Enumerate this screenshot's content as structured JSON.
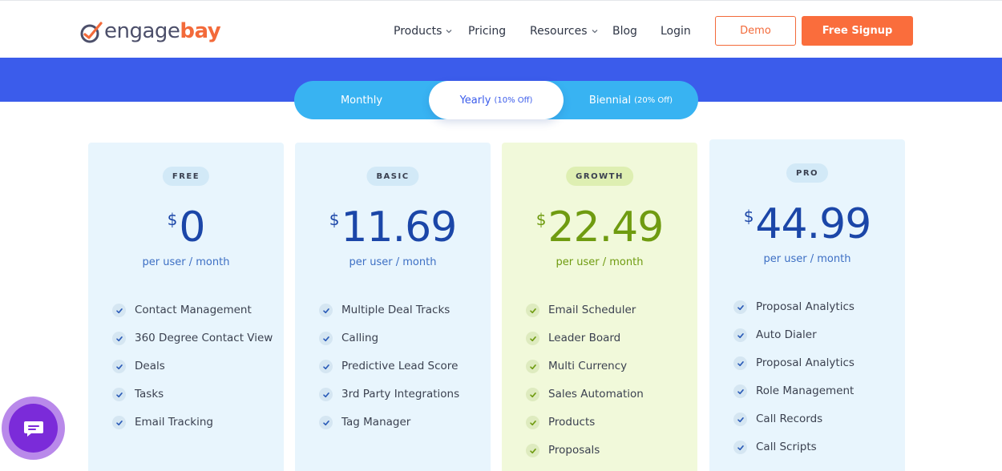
{
  "brand": {
    "logo_part1": "engage",
    "logo_part2": "bay",
    "primary_color": "#3b5ceb",
    "accent_color": "#fa6d3c"
  },
  "nav": {
    "products": "Products",
    "pricing": "Pricing",
    "resources": "Resources",
    "blog": "Blog",
    "login": "Login",
    "demo": "Demo",
    "signup": "Free Signup"
  },
  "billing_toggle": {
    "monthly": {
      "label": "Monthly"
    },
    "yearly": {
      "label": "Yearly",
      "note": "(10% Off)",
      "selected": true
    },
    "biennial": {
      "label": "Biennial",
      "note": "(20% Off)"
    }
  },
  "plans": [
    {
      "badge": "FREE",
      "currency": "$",
      "price": "0",
      "period": "per user / month",
      "features": [
        "Contact Management",
        "360 Degree Contact View",
        "Deals",
        "Tasks",
        "Email Tracking"
      ]
    },
    {
      "badge": "BASIC",
      "currency": "$",
      "price": "11.69",
      "period": "per user / month",
      "features": [
        "Multiple Deal Tracks",
        "Calling",
        "Predictive Lead Score",
        "3rd Party Integrations",
        "Tag Manager"
      ]
    },
    {
      "badge": "GROWTH",
      "currency": "$",
      "price": "22.49",
      "period": "per user / month",
      "features": [
        "Email Scheduler",
        "Leader Board",
        "Multi Currency",
        "Sales Automation",
        "Products",
        "Proposals"
      ]
    },
    {
      "badge": "PRO",
      "currency": "$",
      "price": "44.99",
      "period": "per user / month",
      "features": [
        "Proposal Analytics",
        "Auto Dialer",
        "Proposal Analytics",
        "Role Management",
        "Call Records",
        "Call Scripts"
      ]
    }
  ],
  "chat": {
    "icon": "chat-icon"
  }
}
